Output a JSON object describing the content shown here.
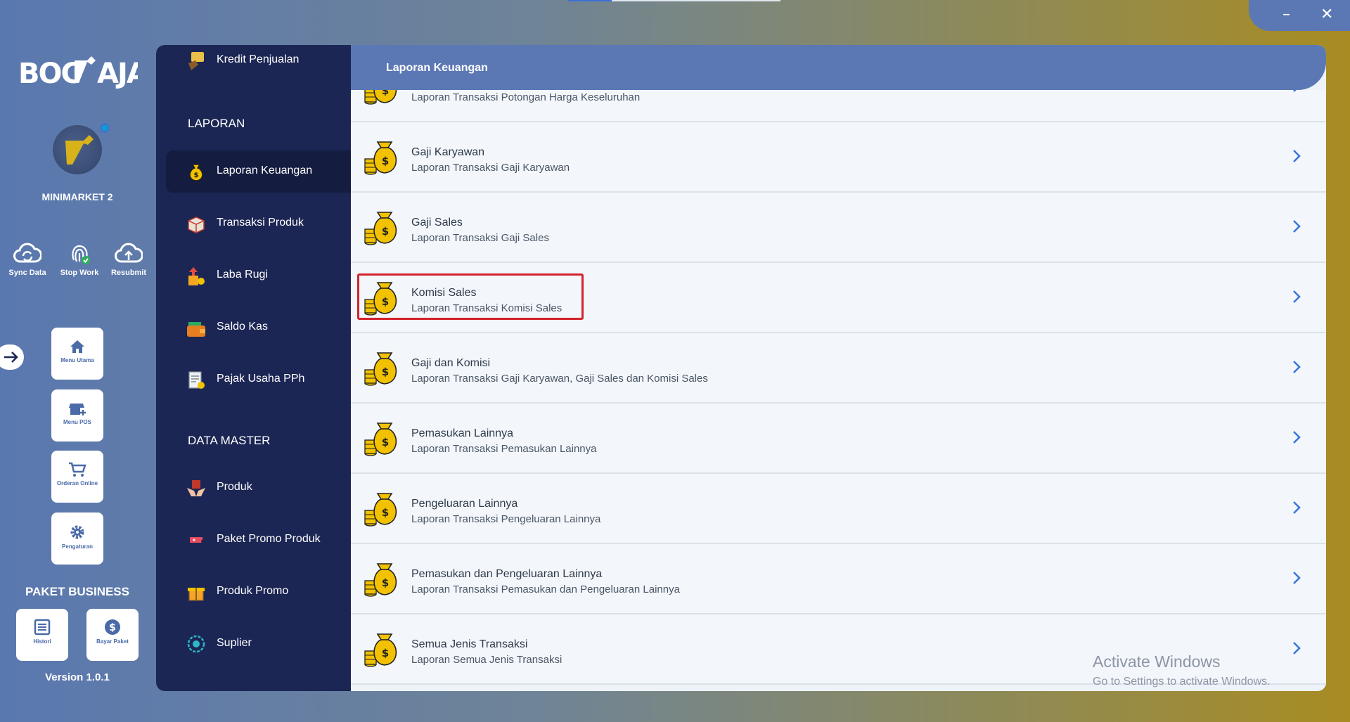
{
  "window": {
    "minimize": "–",
    "close": "✕"
  },
  "brand": {
    "logo": "BOC AJA",
    "store": "MINIMARKET 2"
  },
  "quick_actions": [
    {
      "label": "Sync Data",
      "icon": "cloud-sync-icon"
    },
    {
      "label": "Stop Work",
      "icon": "fingerprint-icon"
    },
    {
      "label": "Resubmit",
      "icon": "cloud-upload-icon"
    }
  ],
  "tiles": [
    {
      "label": "Menu Utama",
      "icon": "home-icon"
    },
    {
      "label": "Menu POS",
      "icon": "store-icon"
    },
    {
      "label": "Orderan Online",
      "icon": "cart-icon"
    },
    {
      "label": "Pengaturan",
      "icon": "gear-icon"
    }
  ],
  "package": {
    "title": "PAKET BUSINESS",
    "histori": "Histori",
    "bayar": "Bayar Paket",
    "version": "Version 1.0.1"
  },
  "nav": {
    "top_item": "Kredit Penjualan",
    "section_laporan": "LAPORAN",
    "laporan": [
      "Laporan Keuangan",
      "Transaksi Produk",
      "Laba Rugi",
      "Saldo Kas",
      "Pajak Usaha PPh"
    ],
    "section_master": "DATA MASTER",
    "master": [
      "Produk",
      "Paket Promo Produk",
      "Produk Promo",
      "Suplier"
    ]
  },
  "header": {
    "title": "Laporan Keuangan"
  },
  "reports": [
    {
      "title": "",
      "sub": "Laporan Transaksi Potongan Harga Keseluruhan"
    },
    {
      "title": "Gaji Karyawan",
      "sub": "Laporan Transaksi Gaji Karyawan"
    },
    {
      "title": "Gaji Sales",
      "sub": "Laporan Transaksi Gaji Sales"
    },
    {
      "title": "Komisi Sales",
      "sub": "Laporan Transaksi Komisi Sales"
    },
    {
      "title": "Gaji dan Komisi",
      "sub": "Laporan Transaksi Gaji Karyawan, Gaji Sales dan Komisi Sales"
    },
    {
      "title": "Pemasukan Lainnya",
      "sub": "Laporan Transaksi Pemasukan Lainnya"
    },
    {
      "title": "Pengeluaran Lainnya",
      "sub": "Laporan Transaksi Pengeluaran Lainnya"
    },
    {
      "title": "Pemasukan dan Pengeluaran Lainnya",
      "sub": "Laporan Transaksi Pemasukan dan Pengeluaran Lainnya"
    },
    {
      "title": "Semua Jenis Transaksi",
      "sub": "Laporan Semua Jenis Transaksi"
    }
  ],
  "watermark": {
    "line1": "Activate Windows",
    "line2": "Go to Settings to activate Windows."
  },
  "colors": {
    "nav_bg": "#1c2654",
    "header_bg": "#5b78b5",
    "accent": "#3b78d8",
    "highlight": "#d3222a"
  }
}
